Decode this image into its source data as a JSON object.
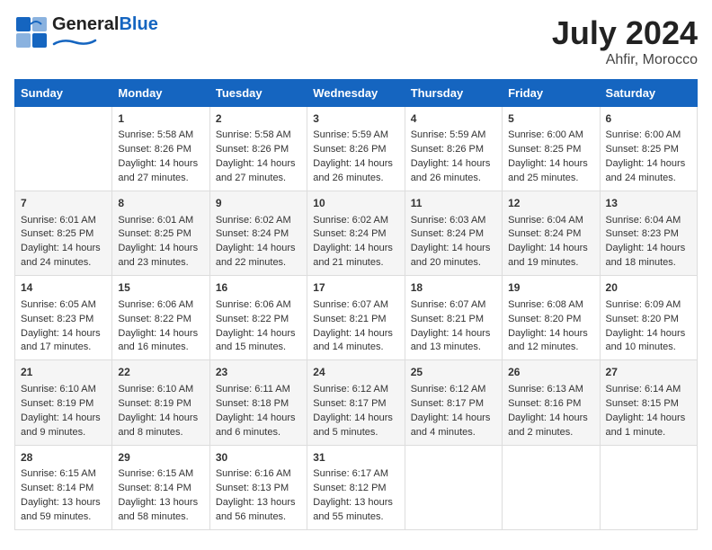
{
  "header": {
    "logo_general": "General",
    "logo_blue": "Blue",
    "month": "July 2024",
    "location": "Ahfir, Morocco"
  },
  "days_of_week": [
    "Sunday",
    "Monday",
    "Tuesday",
    "Wednesday",
    "Thursday",
    "Friday",
    "Saturday"
  ],
  "weeks": [
    [
      {
        "day": "",
        "info": ""
      },
      {
        "day": "1",
        "info": "Sunrise: 5:58 AM\nSunset: 8:26 PM\nDaylight: 14 hours\nand 27 minutes."
      },
      {
        "day": "2",
        "info": "Sunrise: 5:58 AM\nSunset: 8:26 PM\nDaylight: 14 hours\nand 27 minutes."
      },
      {
        "day": "3",
        "info": "Sunrise: 5:59 AM\nSunset: 8:26 PM\nDaylight: 14 hours\nand 26 minutes."
      },
      {
        "day": "4",
        "info": "Sunrise: 5:59 AM\nSunset: 8:26 PM\nDaylight: 14 hours\nand 26 minutes."
      },
      {
        "day": "5",
        "info": "Sunrise: 6:00 AM\nSunset: 8:25 PM\nDaylight: 14 hours\nand 25 minutes."
      },
      {
        "day": "6",
        "info": "Sunrise: 6:00 AM\nSunset: 8:25 PM\nDaylight: 14 hours\nand 24 minutes."
      }
    ],
    [
      {
        "day": "7",
        "info": "Sunrise: 6:01 AM\nSunset: 8:25 PM\nDaylight: 14 hours\nand 24 minutes."
      },
      {
        "day": "8",
        "info": "Sunrise: 6:01 AM\nSunset: 8:25 PM\nDaylight: 14 hours\nand 23 minutes."
      },
      {
        "day": "9",
        "info": "Sunrise: 6:02 AM\nSunset: 8:24 PM\nDaylight: 14 hours\nand 22 minutes."
      },
      {
        "day": "10",
        "info": "Sunrise: 6:02 AM\nSunset: 8:24 PM\nDaylight: 14 hours\nand 21 minutes."
      },
      {
        "day": "11",
        "info": "Sunrise: 6:03 AM\nSunset: 8:24 PM\nDaylight: 14 hours\nand 20 minutes."
      },
      {
        "day": "12",
        "info": "Sunrise: 6:04 AM\nSunset: 8:24 PM\nDaylight: 14 hours\nand 19 minutes."
      },
      {
        "day": "13",
        "info": "Sunrise: 6:04 AM\nSunset: 8:23 PM\nDaylight: 14 hours\nand 18 minutes."
      }
    ],
    [
      {
        "day": "14",
        "info": "Sunrise: 6:05 AM\nSunset: 8:23 PM\nDaylight: 14 hours\nand 17 minutes."
      },
      {
        "day": "15",
        "info": "Sunrise: 6:06 AM\nSunset: 8:22 PM\nDaylight: 14 hours\nand 16 minutes."
      },
      {
        "day": "16",
        "info": "Sunrise: 6:06 AM\nSunset: 8:22 PM\nDaylight: 14 hours\nand 15 minutes."
      },
      {
        "day": "17",
        "info": "Sunrise: 6:07 AM\nSunset: 8:21 PM\nDaylight: 14 hours\nand 14 minutes."
      },
      {
        "day": "18",
        "info": "Sunrise: 6:07 AM\nSunset: 8:21 PM\nDaylight: 14 hours\nand 13 minutes."
      },
      {
        "day": "19",
        "info": "Sunrise: 6:08 AM\nSunset: 8:20 PM\nDaylight: 14 hours\nand 12 minutes."
      },
      {
        "day": "20",
        "info": "Sunrise: 6:09 AM\nSunset: 8:20 PM\nDaylight: 14 hours\nand 10 minutes."
      }
    ],
    [
      {
        "day": "21",
        "info": "Sunrise: 6:10 AM\nSunset: 8:19 PM\nDaylight: 14 hours\nand 9 minutes."
      },
      {
        "day": "22",
        "info": "Sunrise: 6:10 AM\nSunset: 8:19 PM\nDaylight: 14 hours\nand 8 minutes."
      },
      {
        "day": "23",
        "info": "Sunrise: 6:11 AM\nSunset: 8:18 PM\nDaylight: 14 hours\nand 6 minutes."
      },
      {
        "day": "24",
        "info": "Sunrise: 6:12 AM\nSunset: 8:17 PM\nDaylight: 14 hours\nand 5 minutes."
      },
      {
        "day": "25",
        "info": "Sunrise: 6:12 AM\nSunset: 8:17 PM\nDaylight: 14 hours\nand 4 minutes."
      },
      {
        "day": "26",
        "info": "Sunrise: 6:13 AM\nSunset: 8:16 PM\nDaylight: 14 hours\nand 2 minutes."
      },
      {
        "day": "27",
        "info": "Sunrise: 6:14 AM\nSunset: 8:15 PM\nDaylight: 14 hours\nand 1 minute."
      }
    ],
    [
      {
        "day": "28",
        "info": "Sunrise: 6:15 AM\nSunset: 8:14 PM\nDaylight: 13 hours\nand 59 minutes."
      },
      {
        "day": "29",
        "info": "Sunrise: 6:15 AM\nSunset: 8:14 PM\nDaylight: 13 hours\nand 58 minutes."
      },
      {
        "day": "30",
        "info": "Sunrise: 6:16 AM\nSunset: 8:13 PM\nDaylight: 13 hours\nand 56 minutes."
      },
      {
        "day": "31",
        "info": "Sunrise: 6:17 AM\nSunset: 8:12 PM\nDaylight: 13 hours\nand 55 minutes."
      },
      {
        "day": "",
        "info": ""
      },
      {
        "day": "",
        "info": ""
      },
      {
        "day": "",
        "info": ""
      }
    ]
  ]
}
